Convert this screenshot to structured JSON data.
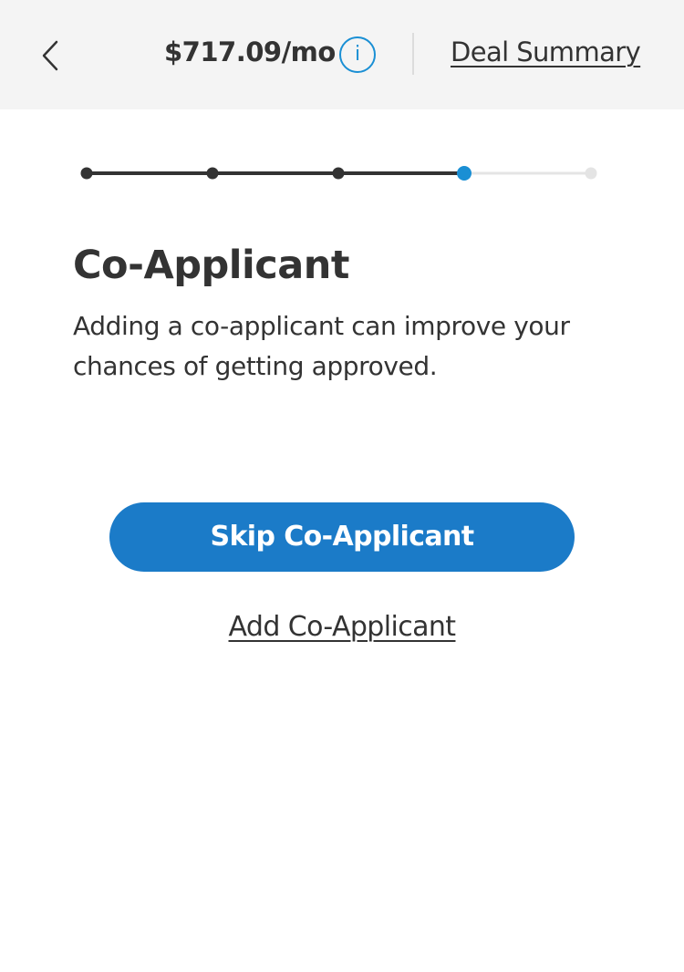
{
  "header": {
    "back_icon": "chevron-left-icon",
    "monthly_payment": "$717.09/mo",
    "info_icon": "info-icon",
    "info_glyph": "i",
    "deal_summary_label": "Deal Summary",
    "accent_color": "#1a8fd4",
    "background_color": "#f4f4f4"
  },
  "progress": {
    "total_steps": 5,
    "current_step": 4,
    "completed_color": "#333333",
    "active_color": "#1a8fd4",
    "pending_color": "#e4e4e4"
  },
  "main": {
    "title": "Co-Applicant",
    "description": "Adding a co-applicant can improve your chances of getting approved.",
    "skip_button_label": "Skip Co-Applicant",
    "add_link_label": "Add Co-Applicant",
    "button_color": "#1b7bc8"
  }
}
